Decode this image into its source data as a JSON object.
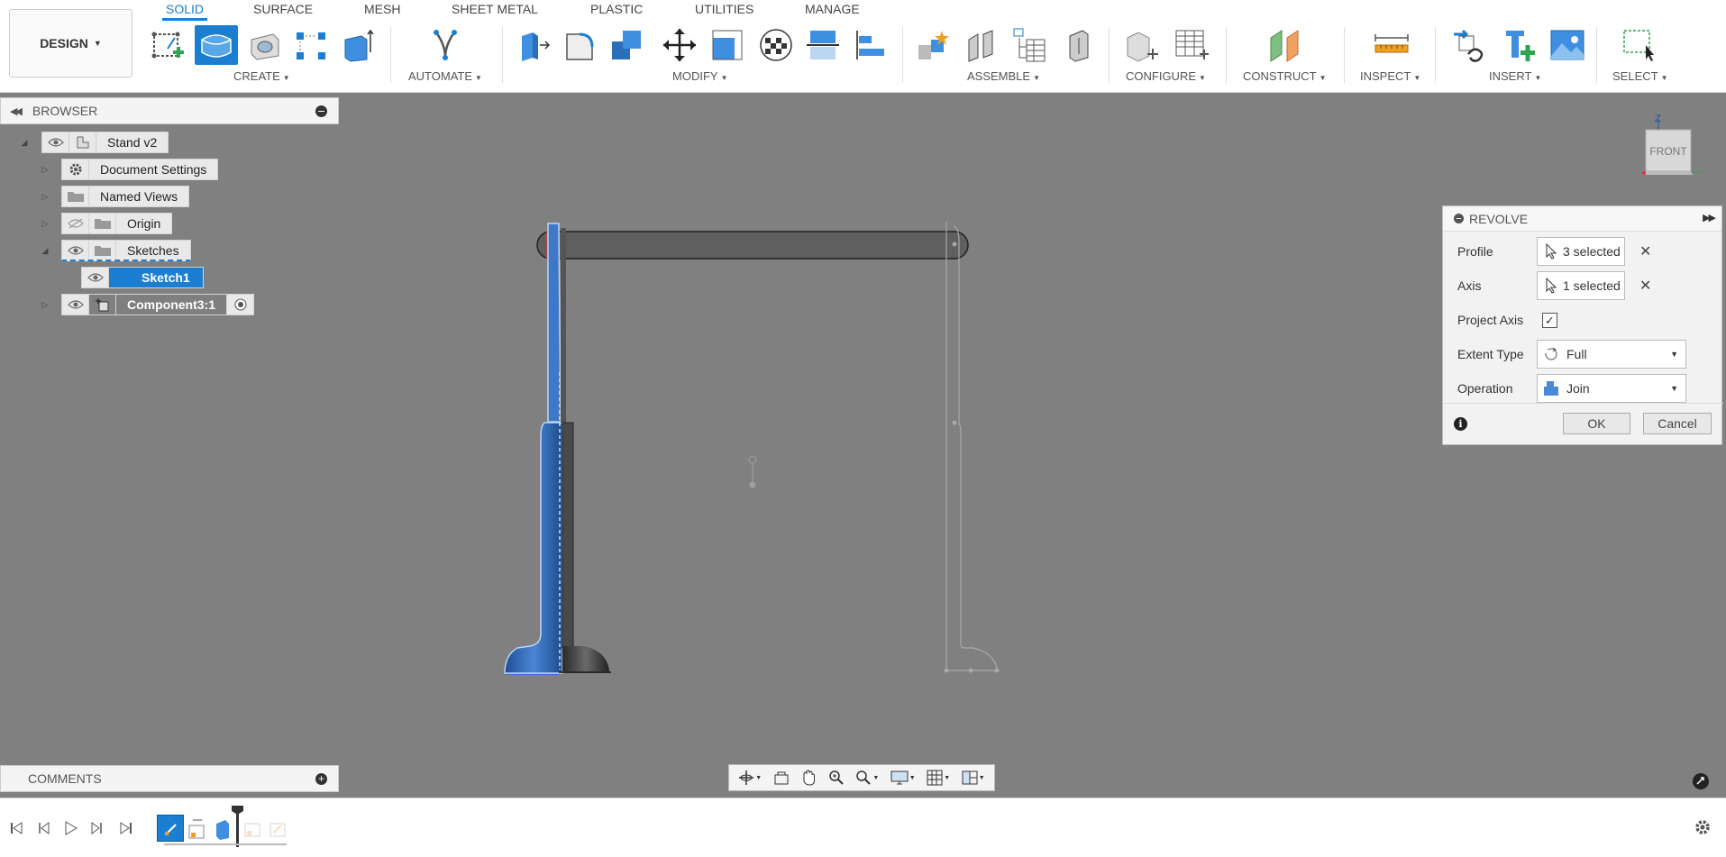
{
  "workspace": {
    "label": "DESIGN"
  },
  "tabs": [
    "SOLID",
    "SURFACE",
    "MESH",
    "SHEET METAL",
    "PLASTIC",
    "UTILITIES",
    "MANAGE"
  ],
  "active_tab": "SOLID",
  "toolbar_groups": {
    "create": "CREATE",
    "automate": "AUTOMATE",
    "modify": "MODIFY",
    "assemble": "ASSEMBLE",
    "configure": "CONFIGURE",
    "construct": "CONSTRUCT",
    "inspect": "INSPECT",
    "insert": "INSERT",
    "select": "SELECT"
  },
  "browser": {
    "title": "BROWSER",
    "root": "Stand v2",
    "items": {
      "document_settings": "Document Settings",
      "named_views": "Named Views",
      "origin": "Origin",
      "sketches": "Sketches",
      "sketch1": "Sketch1",
      "component": "Component3:1"
    }
  },
  "viewcube": {
    "face": "FRONT",
    "axis_z": "Z"
  },
  "revolve": {
    "title": "REVOLVE",
    "profile_label": "Profile",
    "profile_value": "3 selected",
    "axis_label": "Axis",
    "axis_value": "1 selected",
    "project_axis_label": "Project Axis",
    "project_axis_checked": true,
    "extent_label": "Extent Type",
    "extent_value": "Full",
    "operation_label": "Operation",
    "operation_value": "Join",
    "ok": "OK",
    "cancel": "Cancel"
  },
  "comments": {
    "title": "COMMENTS"
  },
  "colors": {
    "accent": "#1b7ed1",
    "viewport": "#808080",
    "body_blue": "#3f78c9",
    "bar_dark": "#5f5f5f"
  }
}
